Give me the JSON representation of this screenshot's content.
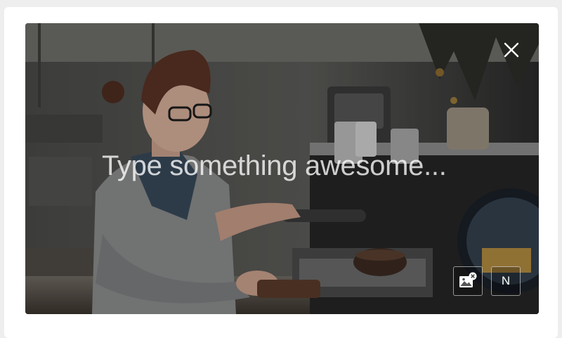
{
  "editor": {
    "placeholder": "Type something awesome...",
    "label_button": "N"
  },
  "icons": {
    "close": "close-icon",
    "remove_image": "image-remove-icon"
  },
  "colors": {
    "overlay_text": "#ffffff",
    "frame": "#ffffff",
    "page_bg": "#eeeeee"
  }
}
